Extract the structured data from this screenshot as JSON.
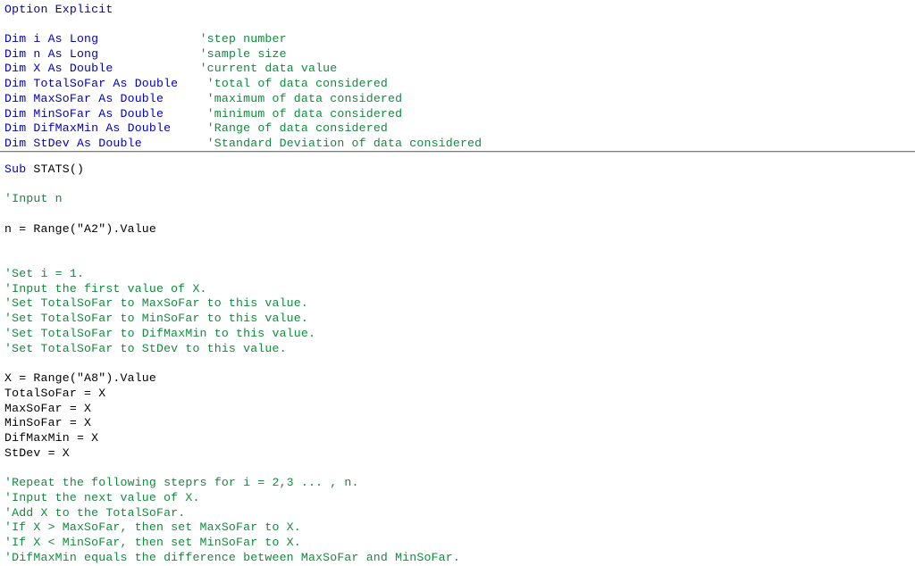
{
  "editor": {
    "language": "vba",
    "background_color": "#ffffff",
    "keyword_color": "#0000C0",
    "comment_color": "#128A3C",
    "text_color": "#000000",
    "divider_color": "#808080",
    "divider_label": "declarations-section-divider"
  },
  "declarations": {
    "lines": [
      {
        "id": "d0",
        "kind": "code",
        "indent": 0,
        "keyword": "Option Explicit",
        "code": "",
        "comment": ""
      },
      {
        "id": "d1",
        "kind": "blank",
        "indent": 0,
        "keyword": "",
        "code": "",
        "comment": ""
      },
      {
        "id": "d2",
        "kind": "declare",
        "indent": 0,
        "keyword": "Dim",
        "code": " i As Long",
        "pad": "              ",
        "comment": "'step number"
      },
      {
        "id": "d3",
        "kind": "declare",
        "indent": 0,
        "keyword": "Dim",
        "code": " n As Long",
        "pad": "              ",
        "comment": "'sample size"
      },
      {
        "id": "d4",
        "kind": "declare",
        "indent": 0,
        "keyword": "Dim",
        "code": " X As Double",
        "pad": "            ",
        "comment": "'current data value"
      },
      {
        "id": "d5",
        "kind": "declare",
        "indent": 0,
        "keyword": "Dim",
        "code": " TotalSoFar As Double",
        "pad": "    ",
        "comment": "'total of data considered"
      },
      {
        "id": "d6",
        "kind": "declare",
        "indent": 0,
        "keyword": "Dim",
        "code": " MaxSoFar As Double",
        "pad": "      ",
        "comment": "'maximum of data considered"
      },
      {
        "id": "d7",
        "kind": "declare",
        "indent": 0,
        "keyword": "Dim",
        "code": " MinSoFar As Double",
        "pad": "      ",
        "comment": "'minimum of data considered"
      },
      {
        "id": "d8",
        "kind": "declare",
        "indent": 0,
        "keyword": "Dim",
        "code": " DifMaxMin As Double",
        "pad": "     ",
        "comment": "'Range of data considered"
      },
      {
        "id": "d9",
        "kind": "declare",
        "indent": 0,
        "keyword": "Dim",
        "code": " StDev As Double",
        "pad": "         ",
        "comment": "'Standard Deviation of data considered"
      }
    ]
  },
  "procedure": {
    "name": "STATS",
    "signature_keyword": "Sub",
    "signature_rest": " STATS()",
    "lines": [
      {
        "id": "p0",
        "kind": "blank",
        "text": ""
      },
      {
        "id": "p1",
        "kind": "comment",
        "text": "'Input n"
      },
      {
        "id": "p2",
        "kind": "blank",
        "text": ""
      },
      {
        "id": "p3",
        "kind": "code",
        "text": "n = Range(\"A2\").Value"
      },
      {
        "id": "p4",
        "kind": "blank",
        "text": ""
      },
      {
        "id": "p5",
        "kind": "blank",
        "text": ""
      },
      {
        "id": "p6",
        "kind": "comment",
        "text": "'Set i = 1."
      },
      {
        "id": "p7",
        "kind": "comment",
        "text": "'Input the first value of X."
      },
      {
        "id": "p8",
        "kind": "comment",
        "text": "'Set TotalSoFar to MaxSoFar to this value."
      },
      {
        "id": "p9",
        "kind": "comment",
        "text": "'Set TotalSoFar to MinSoFar to this value."
      },
      {
        "id": "p10",
        "kind": "comment",
        "text": "'Set TotalSoFar to DifMaxMin to this value."
      },
      {
        "id": "p11",
        "kind": "comment",
        "text": "'Set TotalSoFar to StDev to this value."
      },
      {
        "id": "p12",
        "kind": "blank",
        "text": ""
      },
      {
        "id": "p13",
        "kind": "code",
        "text": "X = Range(\"A8\").Value"
      },
      {
        "id": "p14",
        "kind": "code",
        "text": "TotalSoFar = X"
      },
      {
        "id": "p15",
        "kind": "code",
        "text": "MaxSoFar = X"
      },
      {
        "id": "p16",
        "kind": "code",
        "text": "MinSoFar = X"
      },
      {
        "id": "p17",
        "kind": "code",
        "text": "DifMaxMin = X"
      },
      {
        "id": "p18",
        "kind": "code",
        "text": "StDev = X"
      },
      {
        "id": "p19",
        "kind": "blank",
        "text": ""
      },
      {
        "id": "p20",
        "kind": "comment",
        "text": "'Repeat the following steprs for i = 2,3 ... , n."
      },
      {
        "id": "p21",
        "kind": "comment",
        "text": "'Input the next value of X."
      },
      {
        "id": "p22",
        "kind": "comment",
        "text": "'Add X to the TotalSoFar."
      },
      {
        "id": "p23",
        "kind": "comment",
        "text": "'If X > MaxSoFar, then set MaxSoFar to X."
      },
      {
        "id": "p24",
        "kind": "comment",
        "text": "'If X < MinSoFar, then set MinSoFar to X."
      },
      {
        "id": "p25",
        "kind": "comment",
        "text": "'DifMaxMin equals the difference between MaxSoFar and MinSoFar."
      }
    ]
  }
}
